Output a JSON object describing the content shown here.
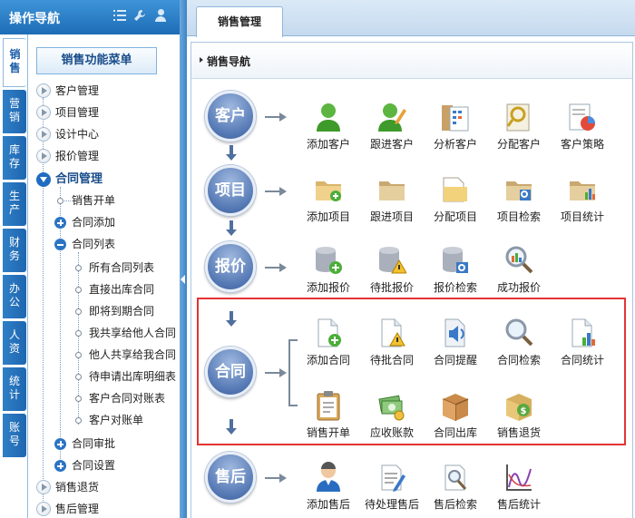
{
  "header": {
    "title": "操作导航"
  },
  "vtabs": [
    {
      "label": "销售",
      "active": true
    },
    {
      "label": "营销"
    },
    {
      "label": "库存"
    },
    {
      "label": "生产"
    },
    {
      "label": "财务"
    },
    {
      "label": "办公"
    },
    {
      "label": "人资"
    },
    {
      "label": "统计"
    },
    {
      "label": "账号"
    }
  ],
  "sidebar": {
    "menu_button": "销售功能菜单",
    "tree": [
      "客户管理",
      "项目管理",
      "设计中心",
      "报价管理",
      "合同管理",
      "销售开单",
      "合同添加",
      "合同列表",
      "所有合同列表",
      "直接出库合同",
      "即将到期合同",
      "我共享给他人合同",
      "他人共享给我合同",
      "待申请出库明细表",
      "客户合同对账表",
      "客户对账单",
      "合同审批",
      "合同设置",
      "销售退货",
      "售后管理"
    ]
  },
  "main": {
    "tab": "销售管理",
    "panel_title": "销售导航",
    "stages": [
      "客户",
      "项目",
      "报价",
      "合同",
      "售后"
    ],
    "customer": [
      "添加客户",
      "跟进客户",
      "分析客户",
      "分配客户",
      "客户策略"
    ],
    "project": [
      "添加项目",
      "跟进项目",
      "分配项目",
      "项目检索",
      "项目统计"
    ],
    "quote": [
      "添加报价",
      "待批报价",
      "报价检索",
      "成功报价"
    ],
    "contract_top": [
      "添加合同",
      "待批合同",
      "合同提醒",
      "合同检索",
      "合同统计"
    ],
    "contract_bottom": [
      "销售开单",
      "应收账款",
      "合同出库",
      "销售退货"
    ],
    "aftersale": [
      "添加售后",
      "待处理售后",
      "售后检索",
      "售后统计"
    ]
  }
}
